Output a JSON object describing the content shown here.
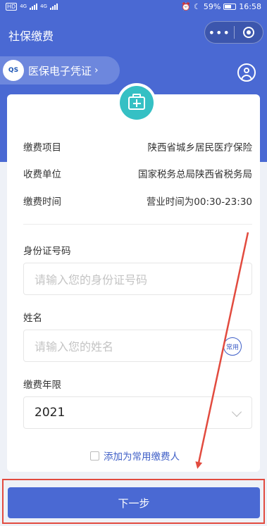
{
  "status_bar": {
    "left_indicators": "HD",
    "network_1": "4G",
    "network_2": "4G",
    "battery": "59%",
    "time": "16:58"
  },
  "nav": {
    "title": "社保缴费",
    "more_icon": "more-dots-icon",
    "close_icon": "target-icon"
  },
  "voucher": {
    "logo_text": "QS",
    "label": "医保电子凭证",
    "chevron": "›"
  },
  "info": [
    {
      "label": "缴费项目",
      "value": "陕西省城乡居民医疗保险"
    },
    {
      "label": "收费单位",
      "value": "国家税务总局陕西省税务局"
    },
    {
      "label": "缴费时间",
      "value": "营业时间为00:30-23:30"
    }
  ],
  "form": {
    "id_label": "身份证号码",
    "id_placeholder": "请输入您的身份证号码",
    "name_label": "姓名",
    "name_placeholder": "请输入您的姓名",
    "common_badge": "常用",
    "year_label": "缴费年限",
    "year_value": "2021",
    "add_payer": "添加为常用缴费人"
  },
  "next_button": "下一步",
  "colors": {
    "primary": "#4a69d3",
    "accent": "#35c0c4",
    "highlight": "#e24b3f"
  }
}
